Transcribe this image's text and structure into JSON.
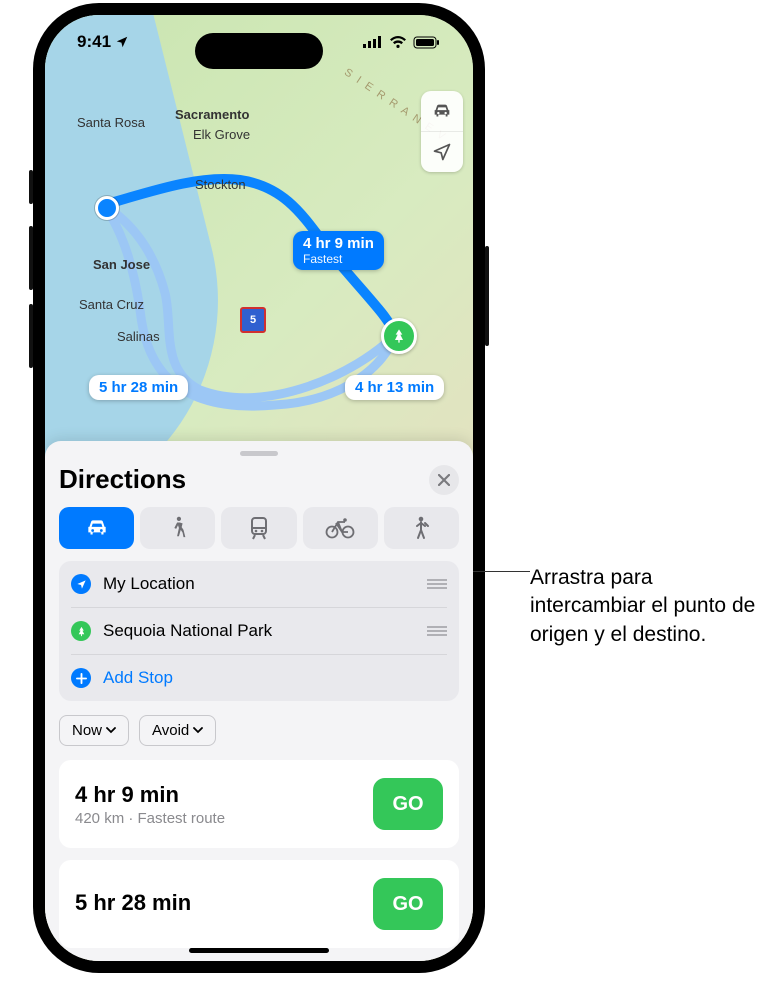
{
  "status": {
    "time": "9:41"
  },
  "map": {
    "cities": {
      "santa_rosa": "Santa Rosa",
      "sacramento": "Sacramento",
      "elk_grove": "Elk Grove",
      "stockton": "Stockton",
      "san_jose": "San Jose",
      "santa_cruz": "Santa Cruz",
      "salinas": "Salinas"
    },
    "ranges": {
      "sierra": "S I E R R A   N E V"
    },
    "highway": "5",
    "callouts": {
      "fastest_time": "4 hr 9 min",
      "fastest_sub": "Fastest",
      "alt1": "5 hr 28 min",
      "alt2": "4 hr 13 min"
    }
  },
  "sheet": {
    "title": "Directions",
    "stops": {
      "from": "My Location",
      "to": "Sequoia National Park",
      "add": "Add Stop"
    },
    "pills": {
      "now": "Now",
      "avoid": "Avoid"
    },
    "routes": [
      {
        "time": "4 hr 9 min",
        "detail": "420 km · Fastest route",
        "go": "GO"
      },
      {
        "time": "5 hr 28 min",
        "detail": "",
        "go": "GO"
      }
    ]
  },
  "annotation": "Arrastra para intercambiar el punto de origen y el destino."
}
